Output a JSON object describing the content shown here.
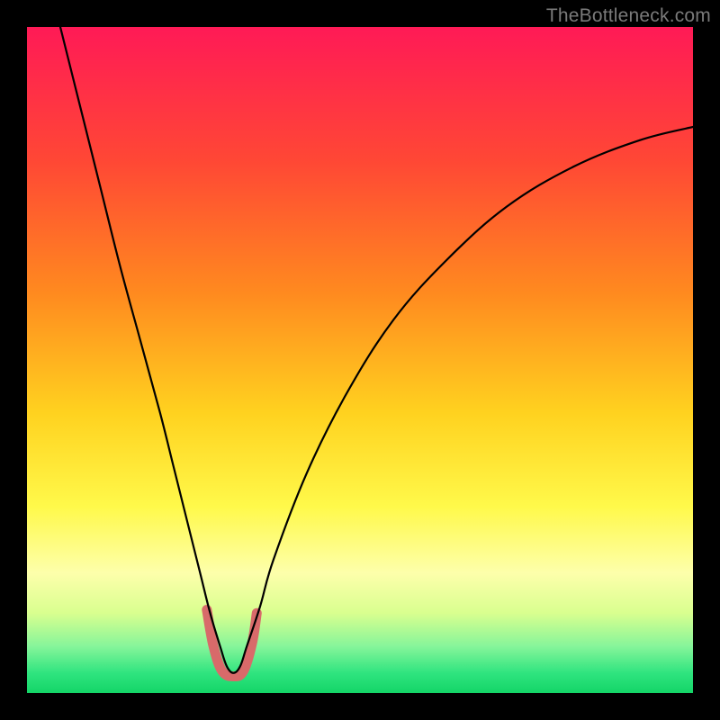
{
  "watermark": "TheBottleneck.com",
  "chart_data": {
    "type": "line",
    "title": "",
    "xlabel": "",
    "ylabel": "",
    "x_range": [
      0,
      100
    ],
    "y_range": [
      0,
      100
    ],
    "background_gradient": {
      "type": "vertical",
      "stops": [
        {
          "pos": 0.0,
          "color": "#ff1a56"
        },
        {
          "pos": 0.2,
          "color": "#ff4735"
        },
        {
          "pos": 0.4,
          "color": "#ff8a1f"
        },
        {
          "pos": 0.58,
          "color": "#ffd21f"
        },
        {
          "pos": 0.72,
          "color": "#fff94a"
        },
        {
          "pos": 0.82,
          "color": "#fdffab"
        },
        {
          "pos": 0.88,
          "color": "#d9ff8f"
        },
        {
          "pos": 0.93,
          "color": "#86f59a"
        },
        {
          "pos": 0.97,
          "color": "#2fe47f"
        },
        {
          "pos": 1.0,
          "color": "#14d567"
        }
      ]
    },
    "series": [
      {
        "name": "bottleneck-curve",
        "color": "#000000",
        "width": 2.2,
        "x": [
          5,
          8,
          11,
          14,
          17,
          20,
          22,
          24,
          26,
          27.5,
          29,
          30,
          31,
          32,
          33,
          35,
          37,
          42,
          48,
          55,
          63,
          72,
          82,
          92,
          100
        ],
        "y": [
          100,
          88,
          76,
          64,
          53,
          42,
          34,
          26,
          18,
          12,
          7,
          4,
          3,
          4,
          7,
          13,
          20,
          33,
          45,
          56,
          65,
          73,
          79,
          83,
          85
        ]
      }
    ],
    "highlight": {
      "name": "optimal-range-marker",
      "color": "#d86a6a",
      "width": 11,
      "linecap": "round",
      "points": [
        {
          "x": 27.0,
          "y": 12.5
        },
        {
          "x": 28.0,
          "y": 7.0
        },
        {
          "x": 29.3,
          "y": 3.3
        },
        {
          "x": 31.0,
          "y": 2.5
        },
        {
          "x": 32.5,
          "y": 3.3
        },
        {
          "x": 33.8,
          "y": 7.5
        },
        {
          "x": 34.5,
          "y": 12.0
        }
      ]
    }
  }
}
